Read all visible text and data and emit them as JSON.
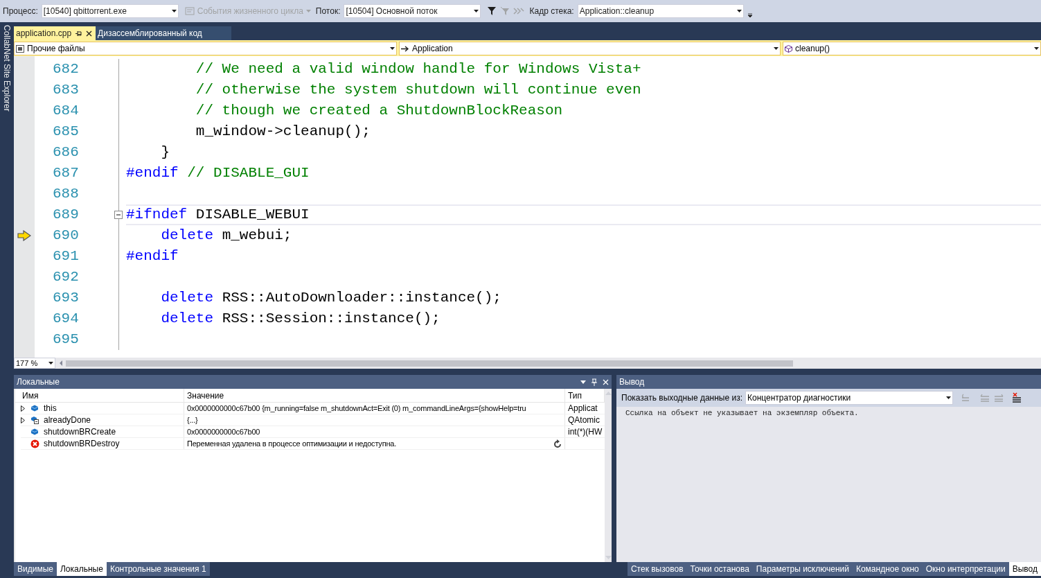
{
  "toolbar": {
    "process_label": "Процесс:",
    "process": "[10540] qbittorrent.exe",
    "lifecycle": {
      "label": "События жизненного цикла",
      "disabled": true
    },
    "thread_label": "Поток:",
    "thread": "[10504] Основной поток",
    "stack_label": "Кадр стека:",
    "stack_frame": "Application::cleanup"
  },
  "side_strip": {
    "title": "CollabNet Site Explorer"
  },
  "doc_tabs": [
    {
      "label": "application.cpp",
      "selected": true
    },
    {
      "label": "Дизассемблированный код",
      "selected": false
    }
  ],
  "nav_bar": {
    "project": "Прочие файлы",
    "scope": "Application",
    "member": "cleanup()"
  },
  "editor": {
    "zoom": "177 %",
    "lines": [
      {
        "number": "682",
        "current": false,
        "fold": false,
        "segments": [
          {
            "kind": "comment",
            "text": "        // We need a valid window handle for Windows Vista+"
          }
        ]
      },
      {
        "number": "683",
        "current": false,
        "fold": false,
        "segments": [
          {
            "kind": "comment",
            "text": "        // otherwise the system shutdown will continue even"
          }
        ]
      },
      {
        "number": "684",
        "current": false,
        "fold": false,
        "segments": [
          {
            "kind": "comment",
            "text": "        // though we created a ShutdownBlockReason"
          }
        ]
      },
      {
        "number": "685",
        "current": false,
        "fold": false,
        "segments": [
          {
            "kind": "plain",
            "text": "        m_window->cleanup();"
          }
        ]
      },
      {
        "number": "686",
        "current": false,
        "fold": false,
        "segments": [
          {
            "kind": "plain",
            "text": "    }"
          }
        ]
      },
      {
        "number": "687",
        "current": false,
        "fold": false,
        "segments": [
          {
            "kind": "keyword",
            "text": "#endif"
          },
          {
            "kind": "comment",
            "text": " // DISABLE_GUI"
          }
        ]
      },
      {
        "number": "688",
        "current": false,
        "fold": false
      },
      {
        "number": "689",
        "current": false,
        "fold": true,
        "segments": [
          {
            "kind": "keyword",
            "text": "#ifndef"
          },
          {
            "kind": "plain",
            "text": " DISABLE_WEBUI"
          }
        ]
      },
      {
        "number": "690",
        "current": true,
        "fold": false,
        "segments": [
          {
            "kind": "keyword",
            "text": "    delete"
          },
          {
            "kind": "plain",
            "text": " m_webui;"
          }
        ]
      },
      {
        "number": "691",
        "current": false,
        "fold": false,
        "segments": [
          {
            "kind": "keyword",
            "text": "#endif"
          }
        ]
      },
      {
        "number": "692",
        "current": false,
        "fold": false
      },
      {
        "number": "693",
        "current": false,
        "fold": false,
        "segments": [
          {
            "kind": "keyword",
            "text": "    delete"
          },
          {
            "kind": "plain",
            "text": " RSS::AutoDownloader::instance();"
          }
        ]
      },
      {
        "number": "694",
        "current": false,
        "fold": false,
        "segments": [
          {
            "kind": "keyword",
            "text": "    delete"
          },
          {
            "kind": "plain",
            "text": " RSS::Session::instance();"
          }
        ]
      },
      {
        "number": "695",
        "current": false,
        "fold": false
      }
    ]
  },
  "locals": {
    "title": "Локальные",
    "columns": [
      "Имя",
      "Значение",
      "Тип"
    ],
    "rows": [
      {
        "name": "this",
        "value": "0x0000000000c67b00 {m_running=false m_shutdownAct=Exit (0) m_commandLineArgs={showHelp=tru",
        "type": "Applicat",
        "kind": "object",
        "expandable": true,
        "refresh": false
      },
      {
        "name": "alreadyDone",
        "value": "{...}",
        "type": "QAtomic",
        "kind": "static",
        "expandable": true,
        "refresh": false
      },
      {
        "name": "shutdownBRCreate",
        "value": "0x0000000000c67b00",
        "type": "int(*)(HW",
        "kind": "object",
        "expandable": false,
        "refresh": false
      },
      {
        "name": "shutdownBRDestroy",
        "value": "Переменная удалена в процессе оптимизации и недоступна.",
        "kind": "error",
        "expandable": false,
        "refresh": true
      }
    ]
  },
  "output": {
    "title": "Вывод",
    "source_label": "Показать выходные данные из:",
    "source": "Концентратор диагностики",
    "text": "Ссылка на объект не указывает на экземпляр объекта."
  },
  "bottom_tabs_left": [
    {
      "label": "Видимые",
      "selected": false
    },
    {
      "label": "Локальные",
      "selected": true
    },
    {
      "label": "Контрольные значения 1",
      "selected": false
    }
  ],
  "bottom_tabs_right": [
    {
      "label": "Стек вызовов",
      "selected": false
    },
    {
      "label": "Точки останова",
      "selected": false
    },
    {
      "label": "Параметры исключений",
      "selected": false
    },
    {
      "label": "Командное окно",
      "selected": false
    },
    {
      "label": "Окно интерпретации",
      "selected": false
    },
    {
      "label": "Вывод",
      "selected": true
    }
  ]
}
